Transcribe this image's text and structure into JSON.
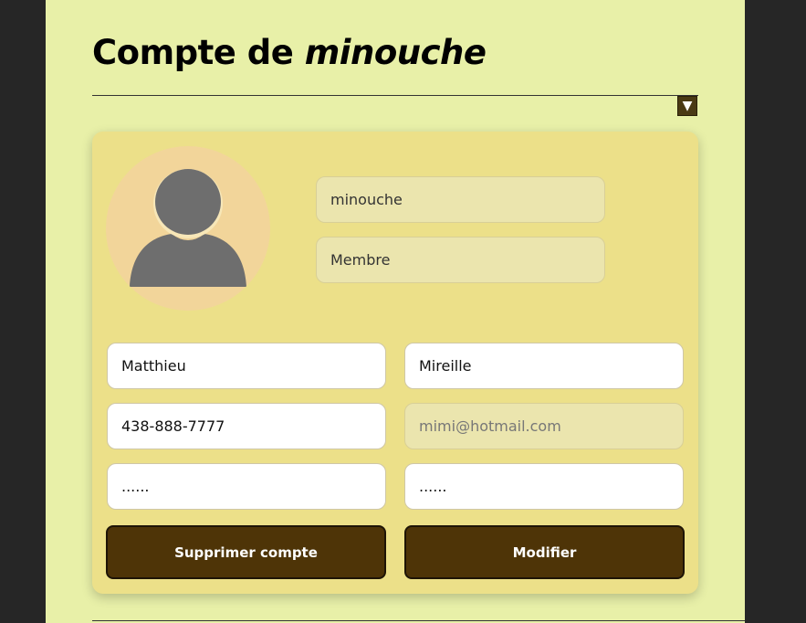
{
  "header": {
    "title_prefix": "Compte de",
    "username": "minouche",
    "toggle_icon": "▼"
  },
  "profile": {
    "avatar_icon": "user-silhouette-icon",
    "username_value": "minouche",
    "role_value": "Membre"
  },
  "form": {
    "first_name": "Matthieu",
    "last_name": "Mireille",
    "phone": "438-888-7777",
    "email": "mimi@hotmail.com",
    "password": "......",
    "password_confirm": "......"
  },
  "actions": {
    "delete_label": "Supprimer compte",
    "modify_label": "Modifier"
  },
  "colors": {
    "page_background": "#e8f0a8",
    "card_background": "#ece089",
    "button_background": "#4e3407",
    "avatar_background": "#f2d59a",
    "outer_background": "#262626"
  }
}
